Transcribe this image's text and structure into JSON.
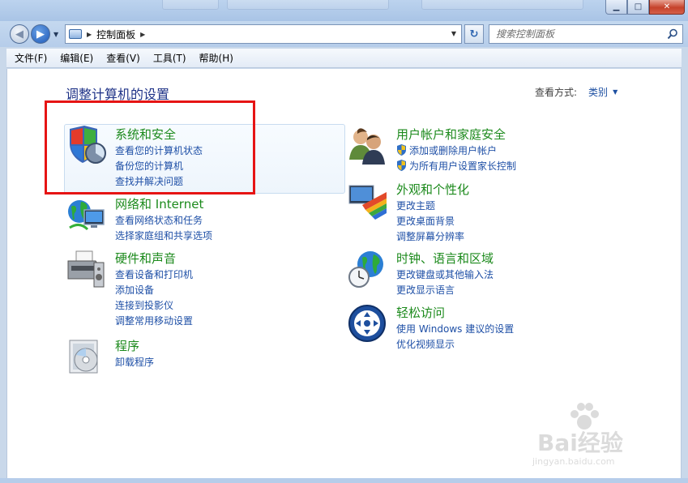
{
  "address": {
    "path": "控制面板"
  },
  "search": {
    "placeholder": "搜索控制面板"
  },
  "menu": [
    "文件(F)",
    "编辑(E)",
    "查看(V)",
    "工具(T)",
    "帮助(H)"
  ],
  "page": {
    "heading": "调整计算机的设置",
    "view_by_label": "查看方式:",
    "view_by_value": "类别"
  },
  "categories": {
    "system": {
      "title": "系统和安全",
      "links": [
        "查看您的计算机状态",
        "备份您的计算机",
        "查找并解决问题"
      ]
    },
    "network": {
      "title": "网络和 Internet",
      "links": [
        "查看网络状态和任务",
        "选择家庭组和共享选项"
      ]
    },
    "hardware": {
      "title": "硬件和声音",
      "links": [
        "查看设备和打印机",
        "添加设备",
        "连接到投影仪",
        "调整常用移动设置"
      ]
    },
    "programs": {
      "title": "程序",
      "links": [
        "卸载程序"
      ]
    },
    "users": {
      "title": "用户帐户和家庭安全",
      "links": [
        "添加或删除用户帐户",
        "为所有用户设置家长控制"
      ]
    },
    "appearance": {
      "title": "外观和个性化",
      "links": [
        "更改主题",
        "更改桌面背景",
        "调整屏幕分辨率"
      ]
    },
    "clock": {
      "title": "时钟、语言和区域",
      "links": [
        "更改键盘或其他输入法",
        "更改显示语言"
      ]
    },
    "ease": {
      "title": "轻松访问",
      "links": [
        "使用 Windows 建议的设置",
        "优化视频显示"
      ]
    }
  },
  "watermark": {
    "brand": "Bai经验",
    "url": "jingyan.baidu.com"
  },
  "colors": {
    "category_title": "#1c8a1c",
    "link": "#1e4fa6",
    "heading": "#1e3287",
    "highlight_box": "#e61414"
  }
}
